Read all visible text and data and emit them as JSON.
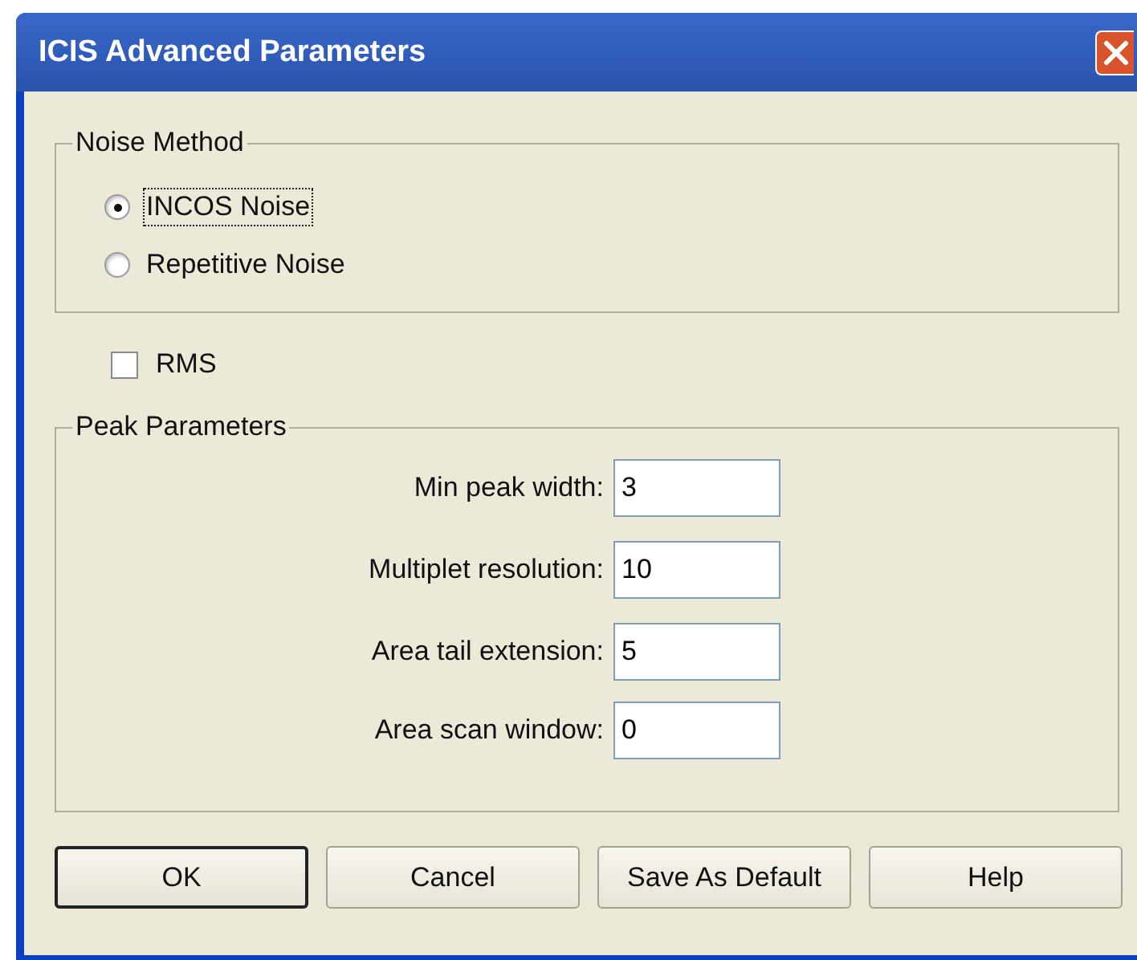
{
  "window": {
    "title": "ICIS Advanced Parameters"
  },
  "noise_method": {
    "label": "Noise Method",
    "options": [
      {
        "label": "INCOS Noise",
        "selected": true,
        "focused": true
      },
      {
        "label": "Repetitive Noise",
        "selected": false,
        "focused": false
      }
    ]
  },
  "rms": {
    "label": "RMS",
    "checked": false
  },
  "peak_parameters": {
    "label": "Peak Parameters",
    "fields": [
      {
        "label": "Min peak width:",
        "value": "3"
      },
      {
        "label": "Multiplet resolution:",
        "value": "10"
      },
      {
        "label": "Area tail extension:",
        "value": "5"
      },
      {
        "label": "Area scan window:",
        "value": "0"
      }
    ]
  },
  "buttons": [
    {
      "label": "OK",
      "default": true
    },
    {
      "label": "Cancel",
      "default": false
    },
    {
      "label": "Save As Default",
      "default": false
    },
    {
      "label": "Help",
      "default": false
    }
  ]
}
